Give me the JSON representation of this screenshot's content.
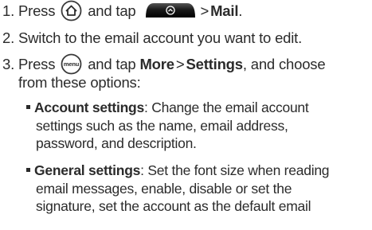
{
  "steps": [
    {
      "number": "1.",
      "text_press": "Press",
      "text_and_tap": "and tap",
      "target": "Mail",
      "icons": [
        "home-icon",
        "launcher-icon"
      ]
    },
    {
      "number": "2.",
      "text": "Switch to the email account you want to edit."
    },
    {
      "number": "3.",
      "text_press": "Press",
      "text_and_tap": "and tap",
      "menu_more": "More",
      "menu_settings": "Settings",
      "text_choose": ", and choose",
      "continuation": "from these options:",
      "icons": [
        "menu-icon"
      ]
    }
  ],
  "options": [
    {
      "title": "Account settings",
      "lines": [
        ": Change the email account",
        "settings such as the name, email address,",
        "password, and description."
      ]
    },
    {
      "title": "General settings",
      "lines": [
        ": Set the font size when reading",
        "email messages, enable, disable or set the",
        "signature, set the account as the default email"
      ]
    }
  ],
  "symbols": {
    "arrow": ">",
    "period": "."
  },
  "icon_labels": {
    "menu": "menu"
  },
  "colors": {
    "text": "#2b2b2b",
    "launcher_button": "#111111",
    "icon_outline": "#3a3a3a"
  }
}
